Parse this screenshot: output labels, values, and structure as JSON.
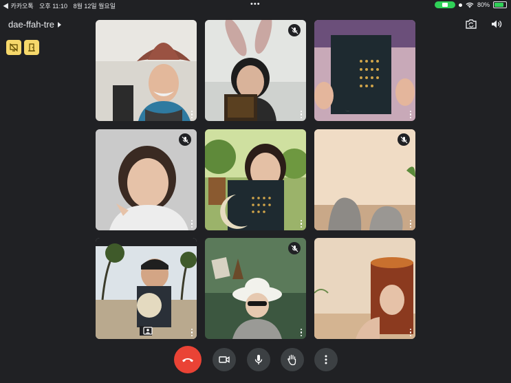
{
  "status_bar": {
    "back_app": "◀ 카카오톡",
    "time": "오후 11:10",
    "date": "8월 12일 월요일",
    "battery": "80%",
    "battery_level": 0.8
  },
  "meeting": {
    "code": "dae-ffah-tre"
  },
  "icons": {
    "camera_switch": "camera-switch-icon",
    "speaker": "speaker-icon",
    "mic_off": "mic-off-icon",
    "more": "more-vert-icon"
  },
  "colors": {
    "background": "#202124",
    "end_call": "#ea4335",
    "control": "#3c4043",
    "badge": "#f6d86b"
  },
  "participants": [
    {
      "muted": false
    },
    {
      "muted": true
    },
    {
      "muted": false
    },
    {
      "muted": true
    },
    {
      "muted": false
    },
    {
      "muted": true
    },
    {
      "muted": false
    },
    {
      "muted": true
    },
    {
      "muted": false
    }
  ],
  "controls": [
    "end-call",
    "camera",
    "microphone",
    "raise-hand",
    "more-options"
  ]
}
